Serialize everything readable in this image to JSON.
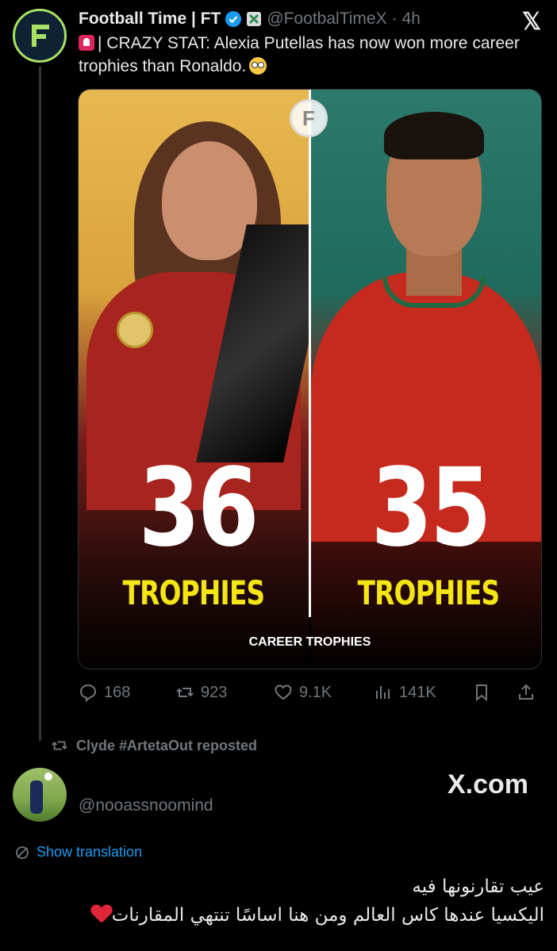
{
  "tweet": {
    "author_name": "Football Time | FT",
    "handle": "@FootbalTimeX",
    "separator": "·",
    "time": "4h",
    "text": "| CRAZY STAT: Alexia Putellas has now won more career trophies than Ronaldo.",
    "icons": [
      "verified-badge-icon",
      "affiliate-badge-icon",
      "siren-emoji",
      "flushed-face-emoji"
    ]
  },
  "media": {
    "left_number": "36",
    "left_label": "TROPHIES",
    "right_number": "35",
    "right_label": "TROPHIES",
    "caption": "CAREER TROPHIES",
    "badge": "F"
  },
  "actions": {
    "replies": "168",
    "reposts": "923",
    "likes": "9.1K",
    "views": "141K"
  },
  "repost": {
    "text": "Clyde #ArtetaOut reposted"
  },
  "reply": {
    "handle": "@nooassnoomind",
    "watermark": "X.com",
    "translate_label": "Show translation",
    "line1": "عيب تقارنونها فيه",
    "line2": "اليكسيا عندها كاس العالم ومن هنا اساسًا تنتهي المقارنات"
  },
  "colors": {
    "background": "#000000",
    "text": "#e7e9ea",
    "muted": "#71767b",
    "link": "#1d9bf0",
    "trophy_label": "#f4e614",
    "verified": "#1d9bf0"
  }
}
